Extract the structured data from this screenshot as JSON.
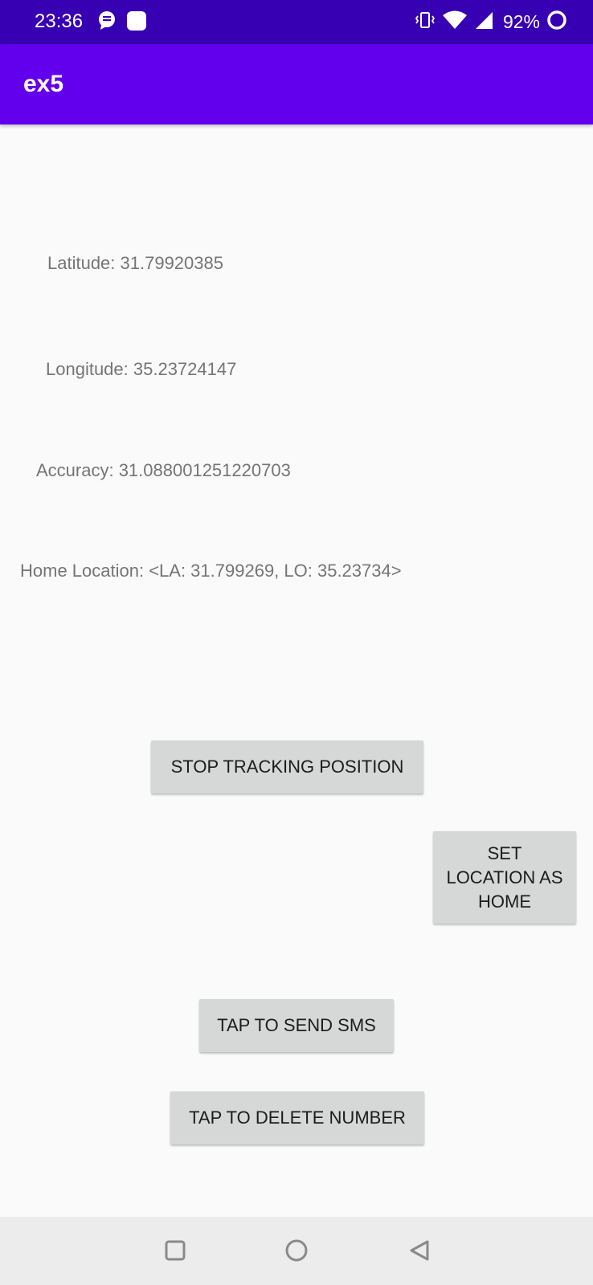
{
  "status_bar": {
    "time": "23:36",
    "battery_percent": "92%",
    "icons": [
      "chat-notification-icon",
      "square-notification-icon",
      "vibrate-icon",
      "wifi-icon",
      "signal-icon",
      "battery-circle-icon"
    ]
  },
  "app_bar": {
    "title": "ex5",
    "color": "#6200ee",
    "status_color": "#3700b3"
  },
  "location": {
    "latitude_text": "Latitude: 31.79920385",
    "longitude_text": "Longitude: 35.23724147",
    "accuracy_text": "Accuracy: 31.088001251220703",
    "home_text": "Home Location: <LA: 31.799269, LO: 35.23734>"
  },
  "buttons": {
    "stop_tracking": "STOP TRACKING POSITION",
    "set_home": "SET LOCATION AS HOME",
    "send_sms": "TAP TO SEND SMS",
    "delete_number": "TAP TO DELETE NUMBER"
  },
  "nav_bar": {
    "icons": [
      "recents-icon",
      "home-icon",
      "back-icon"
    ]
  }
}
